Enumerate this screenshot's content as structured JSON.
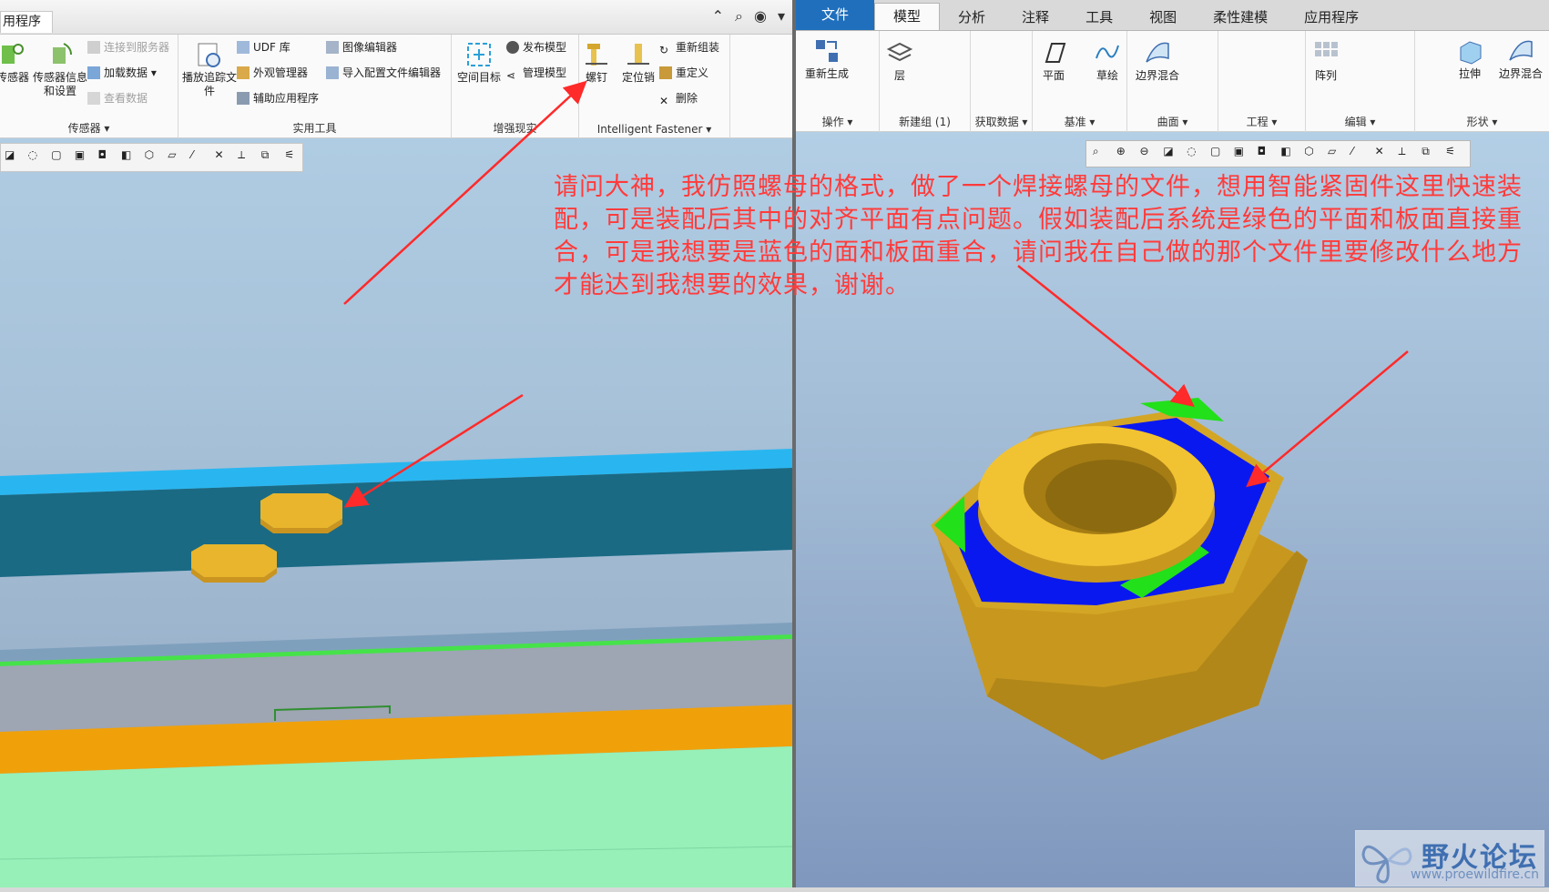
{
  "left": {
    "tab_label": "用程序",
    "groups": {
      "sensors": {
        "label": "传感器 ▾",
        "btn_sensor": "传感器",
        "btn_sensor_info": "传感器信息和设置",
        "connect_server": "连接到服务器",
        "load_data": "加载数据 ▾",
        "view_data": "查看数据"
      },
      "tools": {
        "label": "实用工具",
        "playback": "播放追踪文件",
        "udf": "UDF 库",
        "appearance": "外观管理器",
        "aux_app": "辅助应用程序",
        "image_editor": "图像编辑器",
        "import_config": "导入配置文件编辑器"
      },
      "ar": {
        "label": "增强现实",
        "spatial_target": "空间目标",
        "publish_model": "发布模型",
        "manage_model": "管理模型"
      },
      "fastener": {
        "label": "Intelligent Fastener ▾",
        "screw": "螺钉",
        "pin": "定位销",
        "reassemble": "重新组装",
        "redefine": "重定义",
        "delete": "删除"
      }
    }
  },
  "right": {
    "menu": [
      "文件",
      "模型",
      "分析",
      "注释",
      "工具",
      "视图",
      "柔性建模",
      "应用程序"
    ],
    "active_menu": "模型",
    "groups": {
      "operations": {
        "label": "操作 ▾",
        "regenerate": "重新生成"
      },
      "new_group": {
        "label": "新建组 (1)",
        "layer": "层"
      },
      "get_data": {
        "label": "获取数据 ▾"
      },
      "datum": {
        "label": "基准 ▾",
        "plane": "平面",
        "sketch": "草绘"
      },
      "surface": {
        "label": "曲面 ▾",
        "boundary_blend": "边界混合"
      },
      "engineering": {
        "label": "工程 ▾"
      },
      "edit": {
        "label": "编辑 ▾",
        "pattern": "阵列"
      },
      "shape": {
        "label": "形状 ▾",
        "extrude": "拉伸",
        "boundary_blend2": "边界混合"
      }
    }
  },
  "annotation": {
    "text": "请问大神，我仿照螺母的格式，做了一个焊接螺母的文件，想用智能紧固件这里快速装配，可是装配后其中的对齐平面有点问题。假如装配后系统是绿色的平面和板面直接重合，可是我想要是蓝色的面和板面重合，请问我在自己做的那个文件里要修改什么地方才能达到我想要的效果，谢谢。"
  },
  "watermark": {
    "title": "野火论坛",
    "url": "www.proewildfire.cn"
  },
  "colors": {
    "annotation_red": "#ff3b3b",
    "nut_gold": "#e8b52c",
    "face_blue": "#0a18f0",
    "face_green": "#22e01a",
    "file_tab_blue": "#1f6fbd"
  }
}
